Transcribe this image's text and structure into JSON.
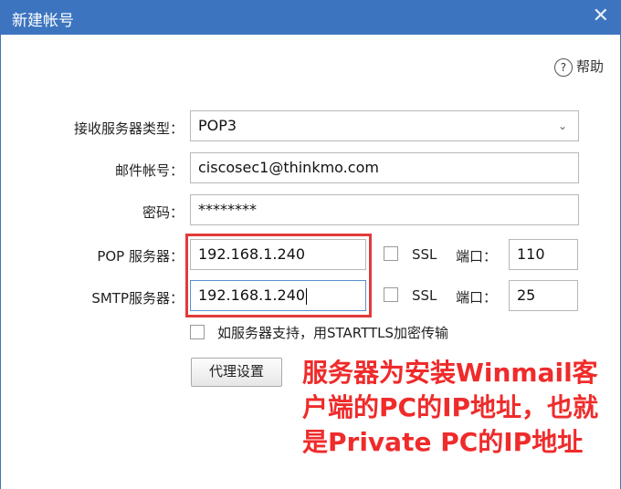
{
  "window": {
    "title": "新建帐号",
    "close_glyph": "✕"
  },
  "help": {
    "label": "帮助",
    "icon_glyph": "?"
  },
  "form": {
    "server_type_label": "接收服务器类型：",
    "server_type_value": "POP3",
    "account_label": "邮件帐号：",
    "account_value": "ciscosec1@thinkmo.com",
    "password_label": "密码：",
    "password_value": "********",
    "pop_label": "POP 服务器：",
    "pop_value": "192.168.1.240",
    "pop_ssl_label": "SSL",
    "pop_port_label": "端口：",
    "pop_port_value": "110",
    "smtp_label": "SMTP服务器：",
    "smtp_value": "192.168.1.240",
    "smtp_ssl_label": "SSL",
    "smtp_port_label": "端口：",
    "smtp_port_value": "25",
    "starttls_label": "如服务器支持，用STARTTLS加密传输",
    "proxy_button": "代理设置"
  },
  "annotation": {
    "line1": "服务器为安装Winmail客",
    "line2": "户端的PC的IP地址，也就",
    "line3": "是Private PC的IP地址",
    "color": "#ef2b2b"
  },
  "colors": {
    "titlebar": "#3c74bf",
    "highlight": "#e23a3a"
  }
}
